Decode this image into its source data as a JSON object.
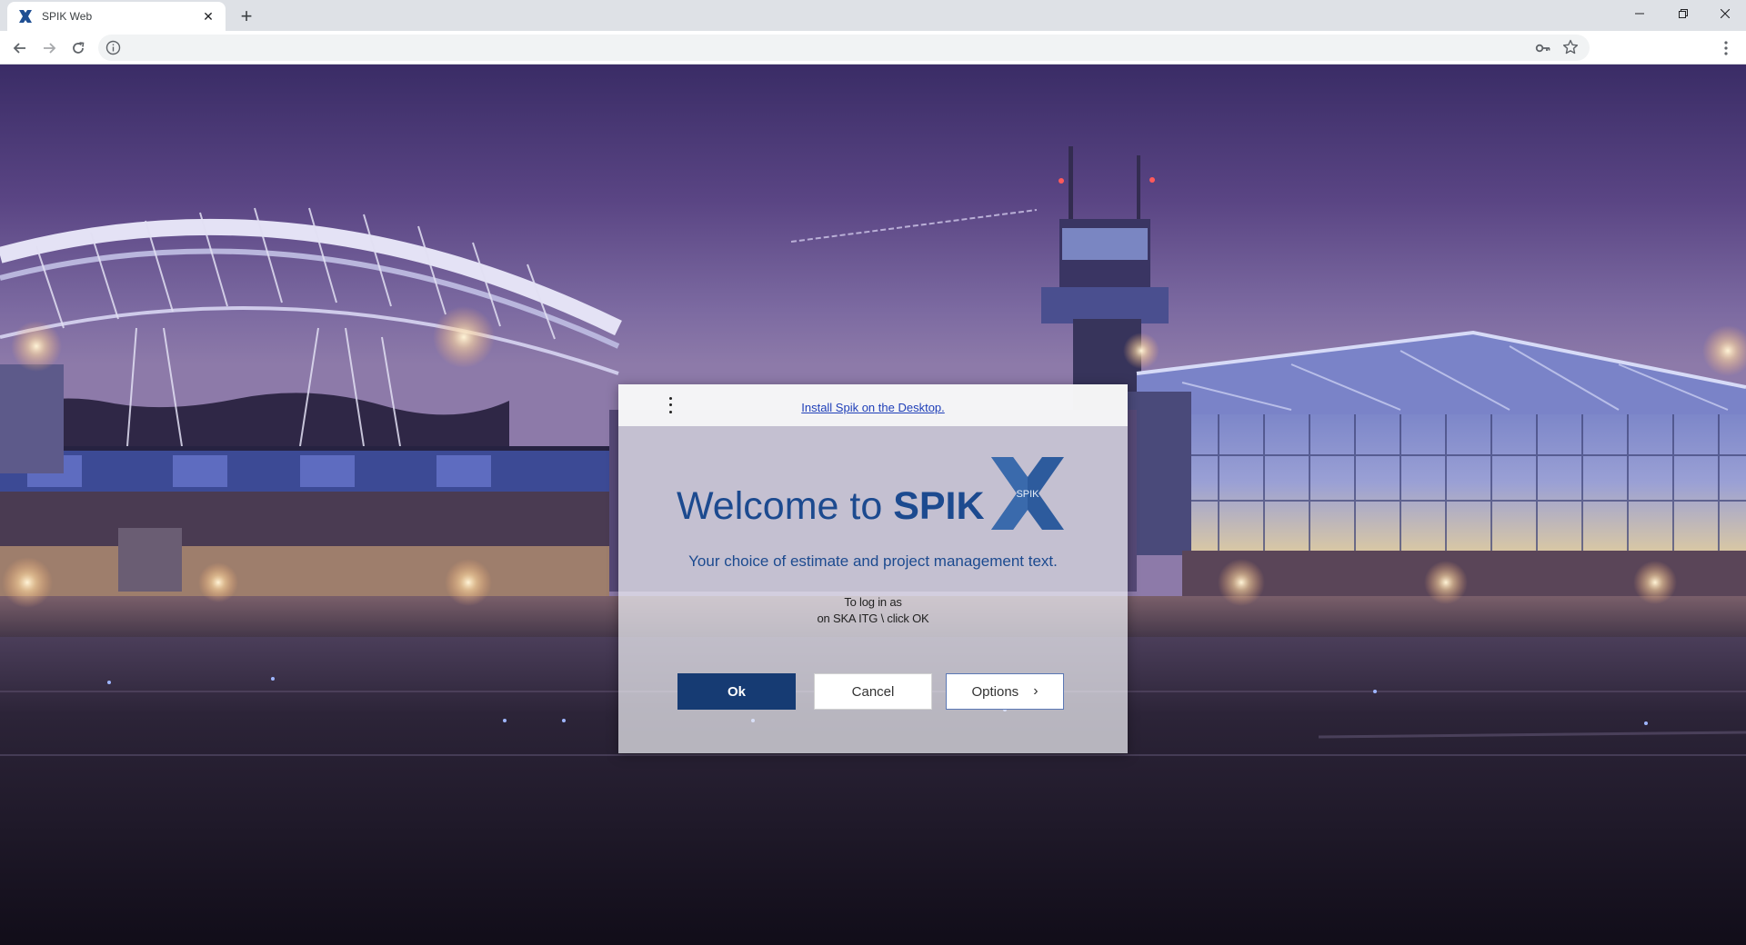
{
  "browser": {
    "tab_title": "SPIK Web",
    "tab_close": "✕",
    "new_tab": "+",
    "icons": [
      "spik-favicon",
      "close-icon",
      "plus-icon",
      "minimize-icon",
      "restore-icon",
      "close-window-icon",
      "back-arrow-icon",
      "forward-arrow-icon",
      "reload-icon",
      "info-icon",
      "key-icon",
      "star-icon",
      "kebab-menu-icon"
    ]
  },
  "dialog": {
    "install_link": "Install Spik on the Desktop.",
    "welcome_prefix": "Welcome to ",
    "welcome_brand": "SPIK",
    "logo_text": "SPIK",
    "tagline": "Your choice of estimate and project management text.",
    "login_line1": "To log in as",
    "login_line2": "on SKA ITG \\ click OK",
    "ok_label": "Ok",
    "cancel_label": "Cancel",
    "options_label": "Options",
    "options_chevron": "›"
  },
  "colors": {
    "brand_blue": "#1c4a8f",
    "ok_button": "#163b73",
    "link": "#1f3fb8"
  }
}
